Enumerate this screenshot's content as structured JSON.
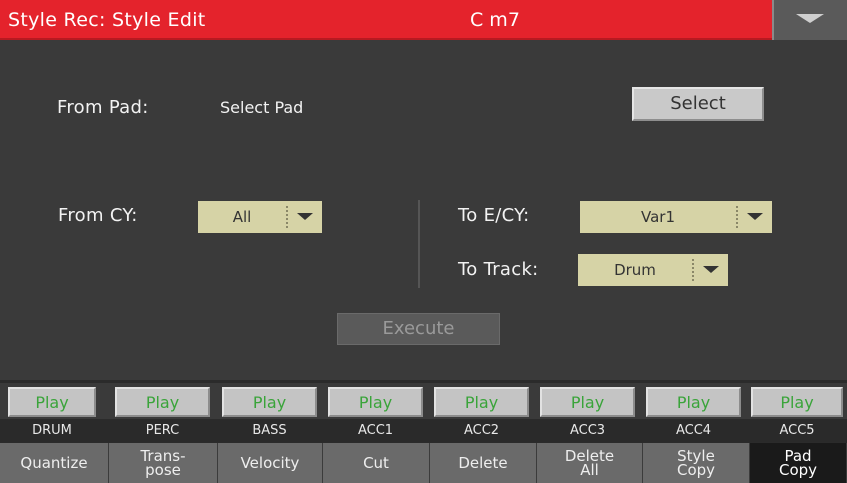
{
  "header": {
    "title": "Style Rec: Style Edit",
    "chord": "C m7",
    "menu_icon": "triangle-down-icon"
  },
  "from_pad": {
    "label": "From Pad:",
    "value": "Select Pad",
    "button": "Select"
  },
  "from_cy": {
    "label": "From CY:",
    "value": "All"
  },
  "to_ecy": {
    "label": "To E/CY:",
    "value": "Var1"
  },
  "to_track": {
    "label": "To Track:",
    "value": "Drum"
  },
  "execute_label": "Execute",
  "play_buttons": [
    "Play",
    "Play",
    "Play",
    "Play",
    "Play",
    "Play",
    "Play",
    "Play"
  ],
  "tracks": [
    "DRUM",
    "PERC",
    "BASS",
    "ACC1",
    "ACC2",
    "ACC3",
    "ACC4",
    "ACC5"
  ],
  "functions": [
    "Quantize",
    "Trans-\npose",
    "Velocity",
    "Cut",
    "Delete",
    "Delete\nAll",
    "Style\nCopy",
    "Pad\nCopy"
  ],
  "active_function_index": 7,
  "colors": {
    "title_bar": "#e4232c",
    "play_text": "#3aa43a",
    "dropdown_bg": "#d6d3a6"
  }
}
